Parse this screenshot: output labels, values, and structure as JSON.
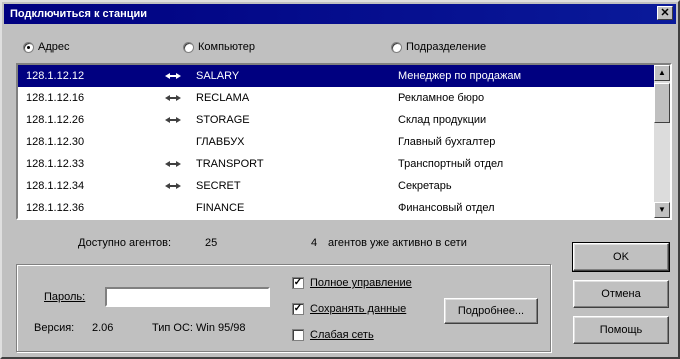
{
  "window": {
    "title": "Подключиться к станции",
    "close_glyph": "✕"
  },
  "modes": [
    {
      "label": "Адрес",
      "checked": true
    },
    {
      "label": "Компьютер",
      "checked": false
    },
    {
      "label": "Подразделение",
      "checked": false
    }
  ],
  "stations": [
    {
      "address": "128.1.12.12",
      "icon": "link-icon",
      "host": "SALARY",
      "description": "Менеджер по продажам",
      "selected": true
    },
    {
      "address": "128.1.12.16",
      "icon": "link-icon",
      "host": "RECLAMA",
      "description": "Рекламное бюро",
      "selected": false
    },
    {
      "address": "128.1.12.26",
      "icon": "link-icon",
      "host": "STORAGE",
      "description": "Склад продукции",
      "selected": false
    },
    {
      "address": "128.1.12.30",
      "icon": "",
      "host": "ГЛАВБУХ",
      "description": "Главный бухгалтер",
      "selected": false
    },
    {
      "address": "128.1.12.33",
      "icon": "link-icon",
      "host": "TRANSPORT",
      "description": "Транспортный отдел",
      "selected": false
    },
    {
      "address": "128.1.12.34",
      "icon": "link-icon",
      "host": "SECRET",
      "description": "Секретарь",
      "selected": false
    },
    {
      "address": "128.1.12.36",
      "icon": "",
      "host": "FINANCE",
      "description": "Финансовый отдел",
      "selected": false
    }
  ],
  "status": {
    "agents_label": "Доступно агентов:",
    "agents_count": "25",
    "active_count": "4",
    "active_label": "агентов уже активно в сети"
  },
  "connection": {
    "password_label": "Пароль:",
    "password_value": "",
    "version_label": "Версия:",
    "version_value": "2.06",
    "os_label": "Тип ОС:",
    "os_value": "Win 95/98"
  },
  "options": [
    {
      "label": "Полное управление",
      "checked": true
    },
    {
      "label": "Сохранять данные",
      "checked": true
    },
    {
      "label": "Слабая сеть",
      "checked": false
    }
  ],
  "buttons": {
    "more": "Подробнее...",
    "ok": "OK",
    "cancel": "Отмена",
    "help": "Помощь"
  }
}
